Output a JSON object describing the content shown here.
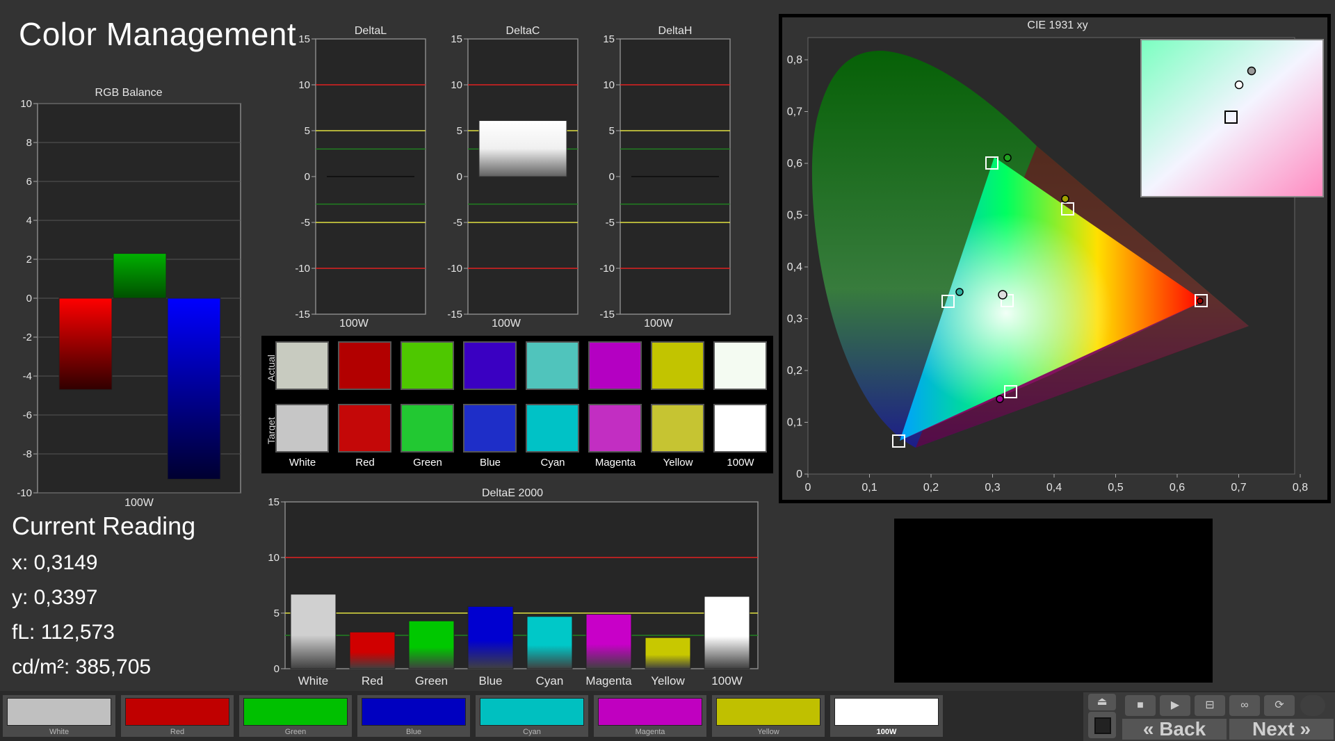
{
  "app_title": "Color Management",
  "rgb_balance": {
    "title": "RGB Balance",
    "ticks": [
      "10",
      "8",
      "6",
      "4",
      "2",
      "0",
      "-2",
      "-4",
      "-6",
      "-8",
      "-10"
    ],
    "xlabel": "100W",
    "bars": [
      {
        "name": "red",
        "value": -4.7,
        "color": "#ff0000"
      },
      {
        "name": "green",
        "value": 2.3,
        "color": "#00a000"
      },
      {
        "name": "blue",
        "value": -9.3,
        "color": "#0000ff"
      }
    ]
  },
  "delta_charts": [
    {
      "title": "DeltaL",
      "value": 0,
      "xlabel": "100W"
    },
    {
      "title": "DeltaC",
      "value": 6.1,
      "xlabel": "100W"
    },
    {
      "title": "DeltaH",
      "value": 0,
      "xlabel": "100W"
    }
  ],
  "delta_ticks": [
    "15",
    "10",
    "5",
    "0",
    "-5",
    "-10",
    "-15"
  ],
  "swatches": {
    "row_labels": {
      "actual": "Actual",
      "target": "Target"
    },
    "items": [
      {
        "label": "White",
        "actual": "#c8cbc0",
        "target": "#c6c6c6"
      },
      {
        "label": "Red",
        "actual": "#b20000",
        "target": "#c40808"
      },
      {
        "label": "Green",
        "actual": "#4ec800",
        "target": "#22c832"
      },
      {
        "label": "Blue",
        "actual": "#3a00c2",
        "target": "#1e2ec8"
      },
      {
        "label": "Cyan",
        "actual": "#50c4bc",
        "target": "#00c2c6"
      },
      {
        "label": "Magenta",
        "actual": "#b400c2",
        "target": "#c22ec2"
      },
      {
        "label": "Yellow",
        "actual": "#c2c400",
        "target": "#c6c432"
      },
      {
        "label": "100W",
        "actual": "#f4fbf2",
        "target": "#ffffff"
      }
    ]
  },
  "cie": {
    "title": "CIE 1931 xy",
    "xticks": [
      "0",
      "0,1",
      "0,2",
      "0,3",
      "0,4",
      "0,5",
      "0,6",
      "0,7",
      "0,8"
    ],
    "yticks": [
      "0",
      "0,1",
      "0,2",
      "0,3",
      "0,4",
      "0,5",
      "0,6",
      "0,7",
      "0,8"
    ]
  },
  "current_reading": {
    "heading": "Current Reading",
    "x": "x: 0,3149",
    "y": "y: 0,3397",
    "fl": "fL: 112,573",
    "cdm2": "cd/m²: 385,705"
  },
  "deltae": {
    "title": "DeltaE 2000",
    "ticks": [
      "15",
      "10",
      "5",
      "0"
    ],
    "bars": [
      {
        "label": "White",
        "value": 6.7,
        "color": "#d0d0d0"
      },
      {
        "label": "Red",
        "value": 3.3,
        "color": "#d00000"
      },
      {
        "label": "Green",
        "value": 4.3,
        "color": "#00c800"
      },
      {
        "label": "Blue",
        "value": 5.6,
        "color": "#0000d0"
      },
      {
        "label": "Cyan",
        "value": 4.7,
        "color": "#00c8c8"
      },
      {
        "label": "Magenta",
        "value": 4.9,
        "color": "#c800c8"
      },
      {
        "label": "Yellow",
        "value": 2.8,
        "color": "#c8c800"
      },
      {
        "label": "100W",
        "value": 6.5,
        "color": "#ffffff"
      }
    ]
  },
  "patches": [
    {
      "label": "White",
      "color": "#c0c0c0"
    },
    {
      "label": "Red",
      "color": "#c00000"
    },
    {
      "label": "Green",
      "color": "#00c000"
    },
    {
      "label": "Blue",
      "color": "#0000c0"
    },
    {
      "label": "Cyan",
      "color": "#00c0c0"
    },
    {
      "label": "Magenta",
      "color": "#c000c0"
    },
    {
      "label": "Yellow",
      "color": "#c0c000"
    },
    {
      "label": "100W",
      "color": "#ffffff"
    }
  ],
  "nav": {
    "back": "Back",
    "next": "Next"
  }
}
